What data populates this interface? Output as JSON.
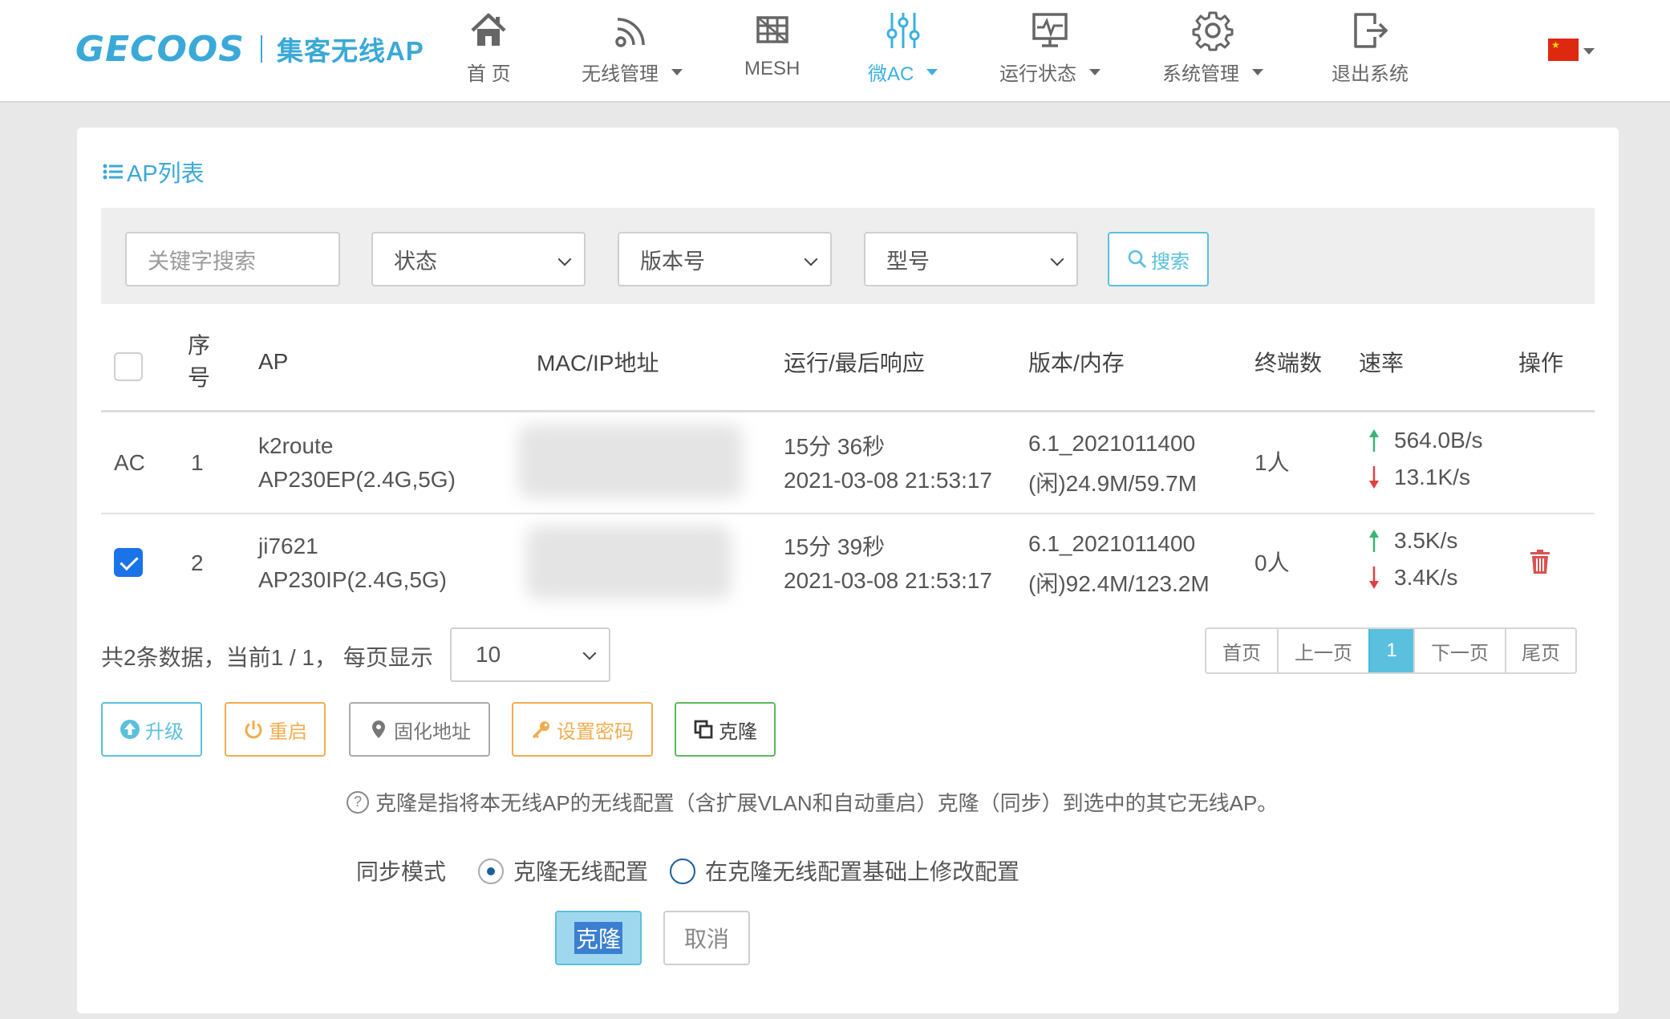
{
  "header": {
    "brand": "GECOOS",
    "brand_sub": "集客无线AP",
    "nav": [
      {
        "label": "首 页",
        "icon": "home-icon"
      },
      {
        "label": "无线管理",
        "icon": "wifi-icon",
        "dropdown": true
      },
      {
        "label": "MESH",
        "icon": "mesh-icon"
      },
      {
        "label": "微AC",
        "icon": "sliders-icon",
        "dropdown": true,
        "active": true
      },
      {
        "label": "运行状态",
        "icon": "monitor-icon",
        "dropdown": true
      },
      {
        "label": "系统管理",
        "icon": "gear-icon",
        "dropdown": true
      },
      {
        "label": "退出系统",
        "icon": "logout-icon"
      }
    ],
    "language_flag": "cn-flag-icon"
  },
  "card": {
    "title": "AP列表",
    "filters": {
      "keyword_placeholder": "关键字搜索",
      "status": "状态",
      "version": "版本号",
      "model": "型号",
      "search_button": "搜索"
    },
    "table": {
      "headers": {
        "index": "序号",
        "ap": "AP",
        "mac_ip": "MAC/IP地址",
        "runtime": "运行/最后响应",
        "version_mem": "版本/内存",
        "clients": "终端数",
        "rate": "速率",
        "actions": "操作"
      },
      "rows": [
        {
          "tag": "AC",
          "checked": false,
          "index": "1",
          "name": "k2route",
          "model": "AP230EP(2.4G,5G)",
          "uptime": "15分 36秒",
          "last_seen": "2021-03-08 21:53:17",
          "version": "6.1_2021011400",
          "memory": "(闲)24.9M/59.7M",
          "clients": "1人",
          "rate_up": "564.0B/s",
          "rate_down": "13.1K/s",
          "deletable": false
        },
        {
          "tag": "",
          "checked": true,
          "index": "2",
          "name": "ji7621",
          "model": "AP230IP(2.4G,5G)",
          "uptime": "15分 39秒",
          "last_seen": "2021-03-08 21:53:17",
          "version": "6.1_2021011400",
          "memory": "(闲)92.4M/123.2M",
          "clients": "0人",
          "rate_up": "3.5K/s",
          "rate_down": "3.4K/s",
          "deletable": true
        }
      ]
    },
    "pagination": {
      "summary": "共2条数据，当前1 / 1， 每页显示",
      "page_size": "10",
      "first": "首页",
      "prev": "上一页",
      "current": "1",
      "next": "下一页",
      "last": "尾页"
    },
    "actions": {
      "upgrade": "升级",
      "reboot": "重启",
      "fix_address": "固化地址",
      "set_password": "设置密码",
      "clone": "克隆"
    },
    "clone_panel": {
      "hint": "克隆是指将本无线AP的无线配置（含扩展VLAN和自动重启）克隆（同步）到选中的其它无线AP。",
      "sync_mode_label": "同步模式",
      "option_clone": "克隆无线配置",
      "option_modify": "在克隆无线配置基础上修改配置",
      "selected_option": "克隆无线配置",
      "confirm_button": "克隆",
      "cancel_button": "取消"
    }
  },
  "colors": {
    "accent": "#3aa9d8",
    "info": "#5bc0de",
    "warning": "#f0ad4e",
    "success": "#5cb85c",
    "danger": "#d9534f",
    "checkbox": "#1a73e8"
  }
}
